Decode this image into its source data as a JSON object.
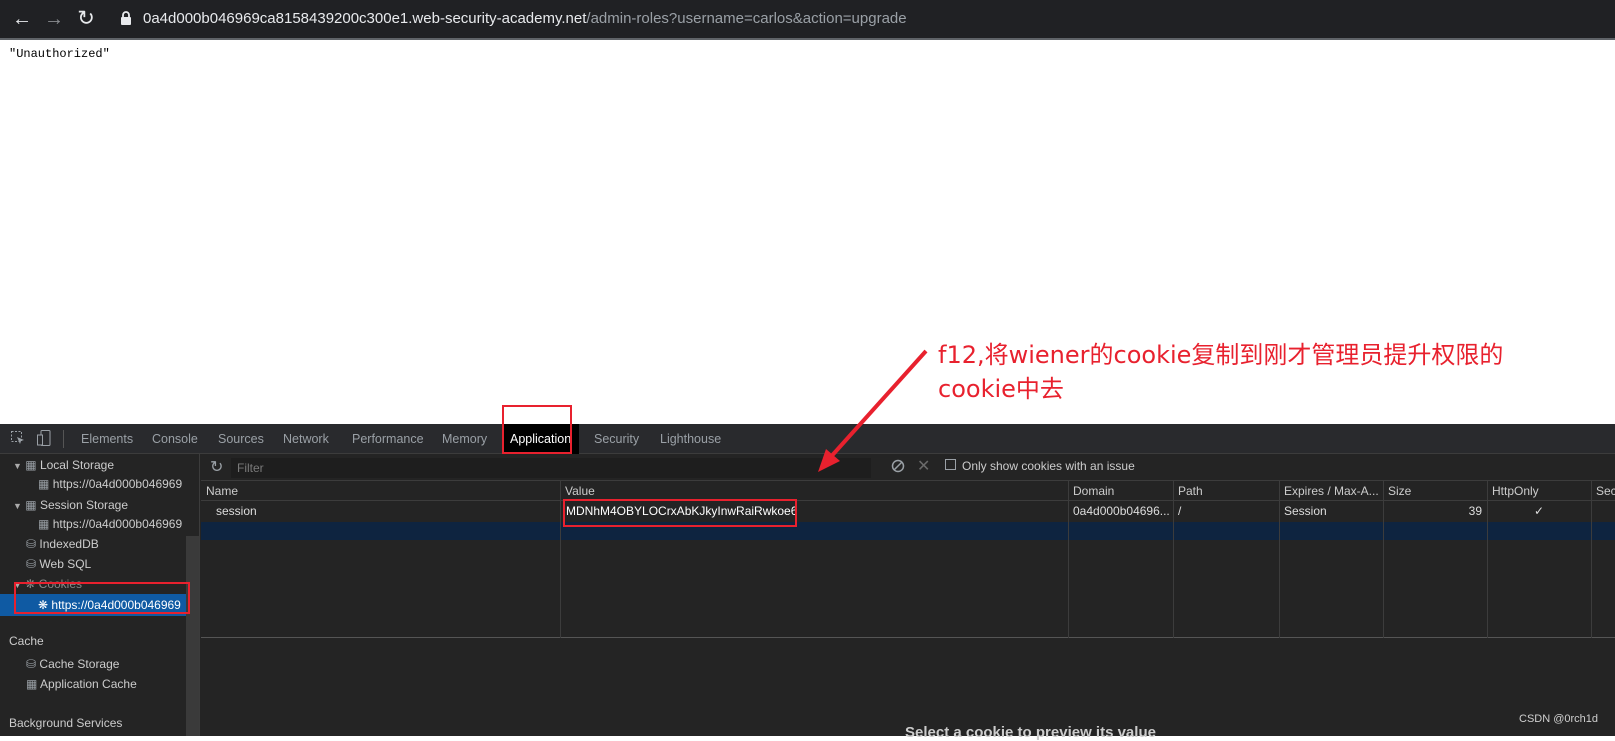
{
  "browser": {
    "url_host": "0a4d000b046969ca8158439200c300e1.web-security-academy.net",
    "url_path": "/admin-roles?username=carlos&action=upgrade"
  },
  "page": {
    "body_text": "\"Unauthorized\""
  },
  "annotation": {
    "text": "f12,将wiener的cookie复制到刚才管理员提升权限的cookie中去"
  },
  "devtools": {
    "tabs": [
      "Elements",
      "Console",
      "Sources",
      "Network",
      "Performance",
      "Memory",
      "Application",
      "Security",
      "Lighthouse"
    ],
    "active_tab": "Application",
    "sidebar": {
      "local_storage": "Local Storage",
      "local_storage_origin": "https://0a4d000b046969",
      "session_storage": "Session Storage",
      "session_storage_origin": "https://0a4d000b046969",
      "indexeddb": "IndexedDB",
      "websql": "Web SQL",
      "cookies": "Cookies",
      "cookies_origin": "https://0a4d000b046969",
      "cache_heading": "Cache",
      "cache_storage": "Cache Storage",
      "application_cache": "Application Cache",
      "background_services": "Background Services"
    },
    "toolbar": {
      "filter_placeholder": "Filter",
      "only_issues_label": "Only show cookies with an issue"
    },
    "cookie_table": {
      "columns": [
        "Name",
        "Value",
        "Domain",
        "Path",
        "Expires / Max-A...",
        "Size",
        "HttpOnly",
        "Sec"
      ],
      "rows": [
        {
          "name": "session",
          "value": "MDNhM4OBYLOCrxAbKJkyInwRaiRwkoe6",
          "domain": "0a4d000b04696...",
          "path": "/",
          "expires": "Session",
          "size": "39",
          "httponly": "✓"
        }
      ]
    },
    "empty_hint": "Select a cookie to preview its value"
  },
  "watermark": "CSDN @0rch1d",
  "colors": {
    "annotation_red": "#e8212e",
    "selected_blue": "#0f5aa3"
  }
}
